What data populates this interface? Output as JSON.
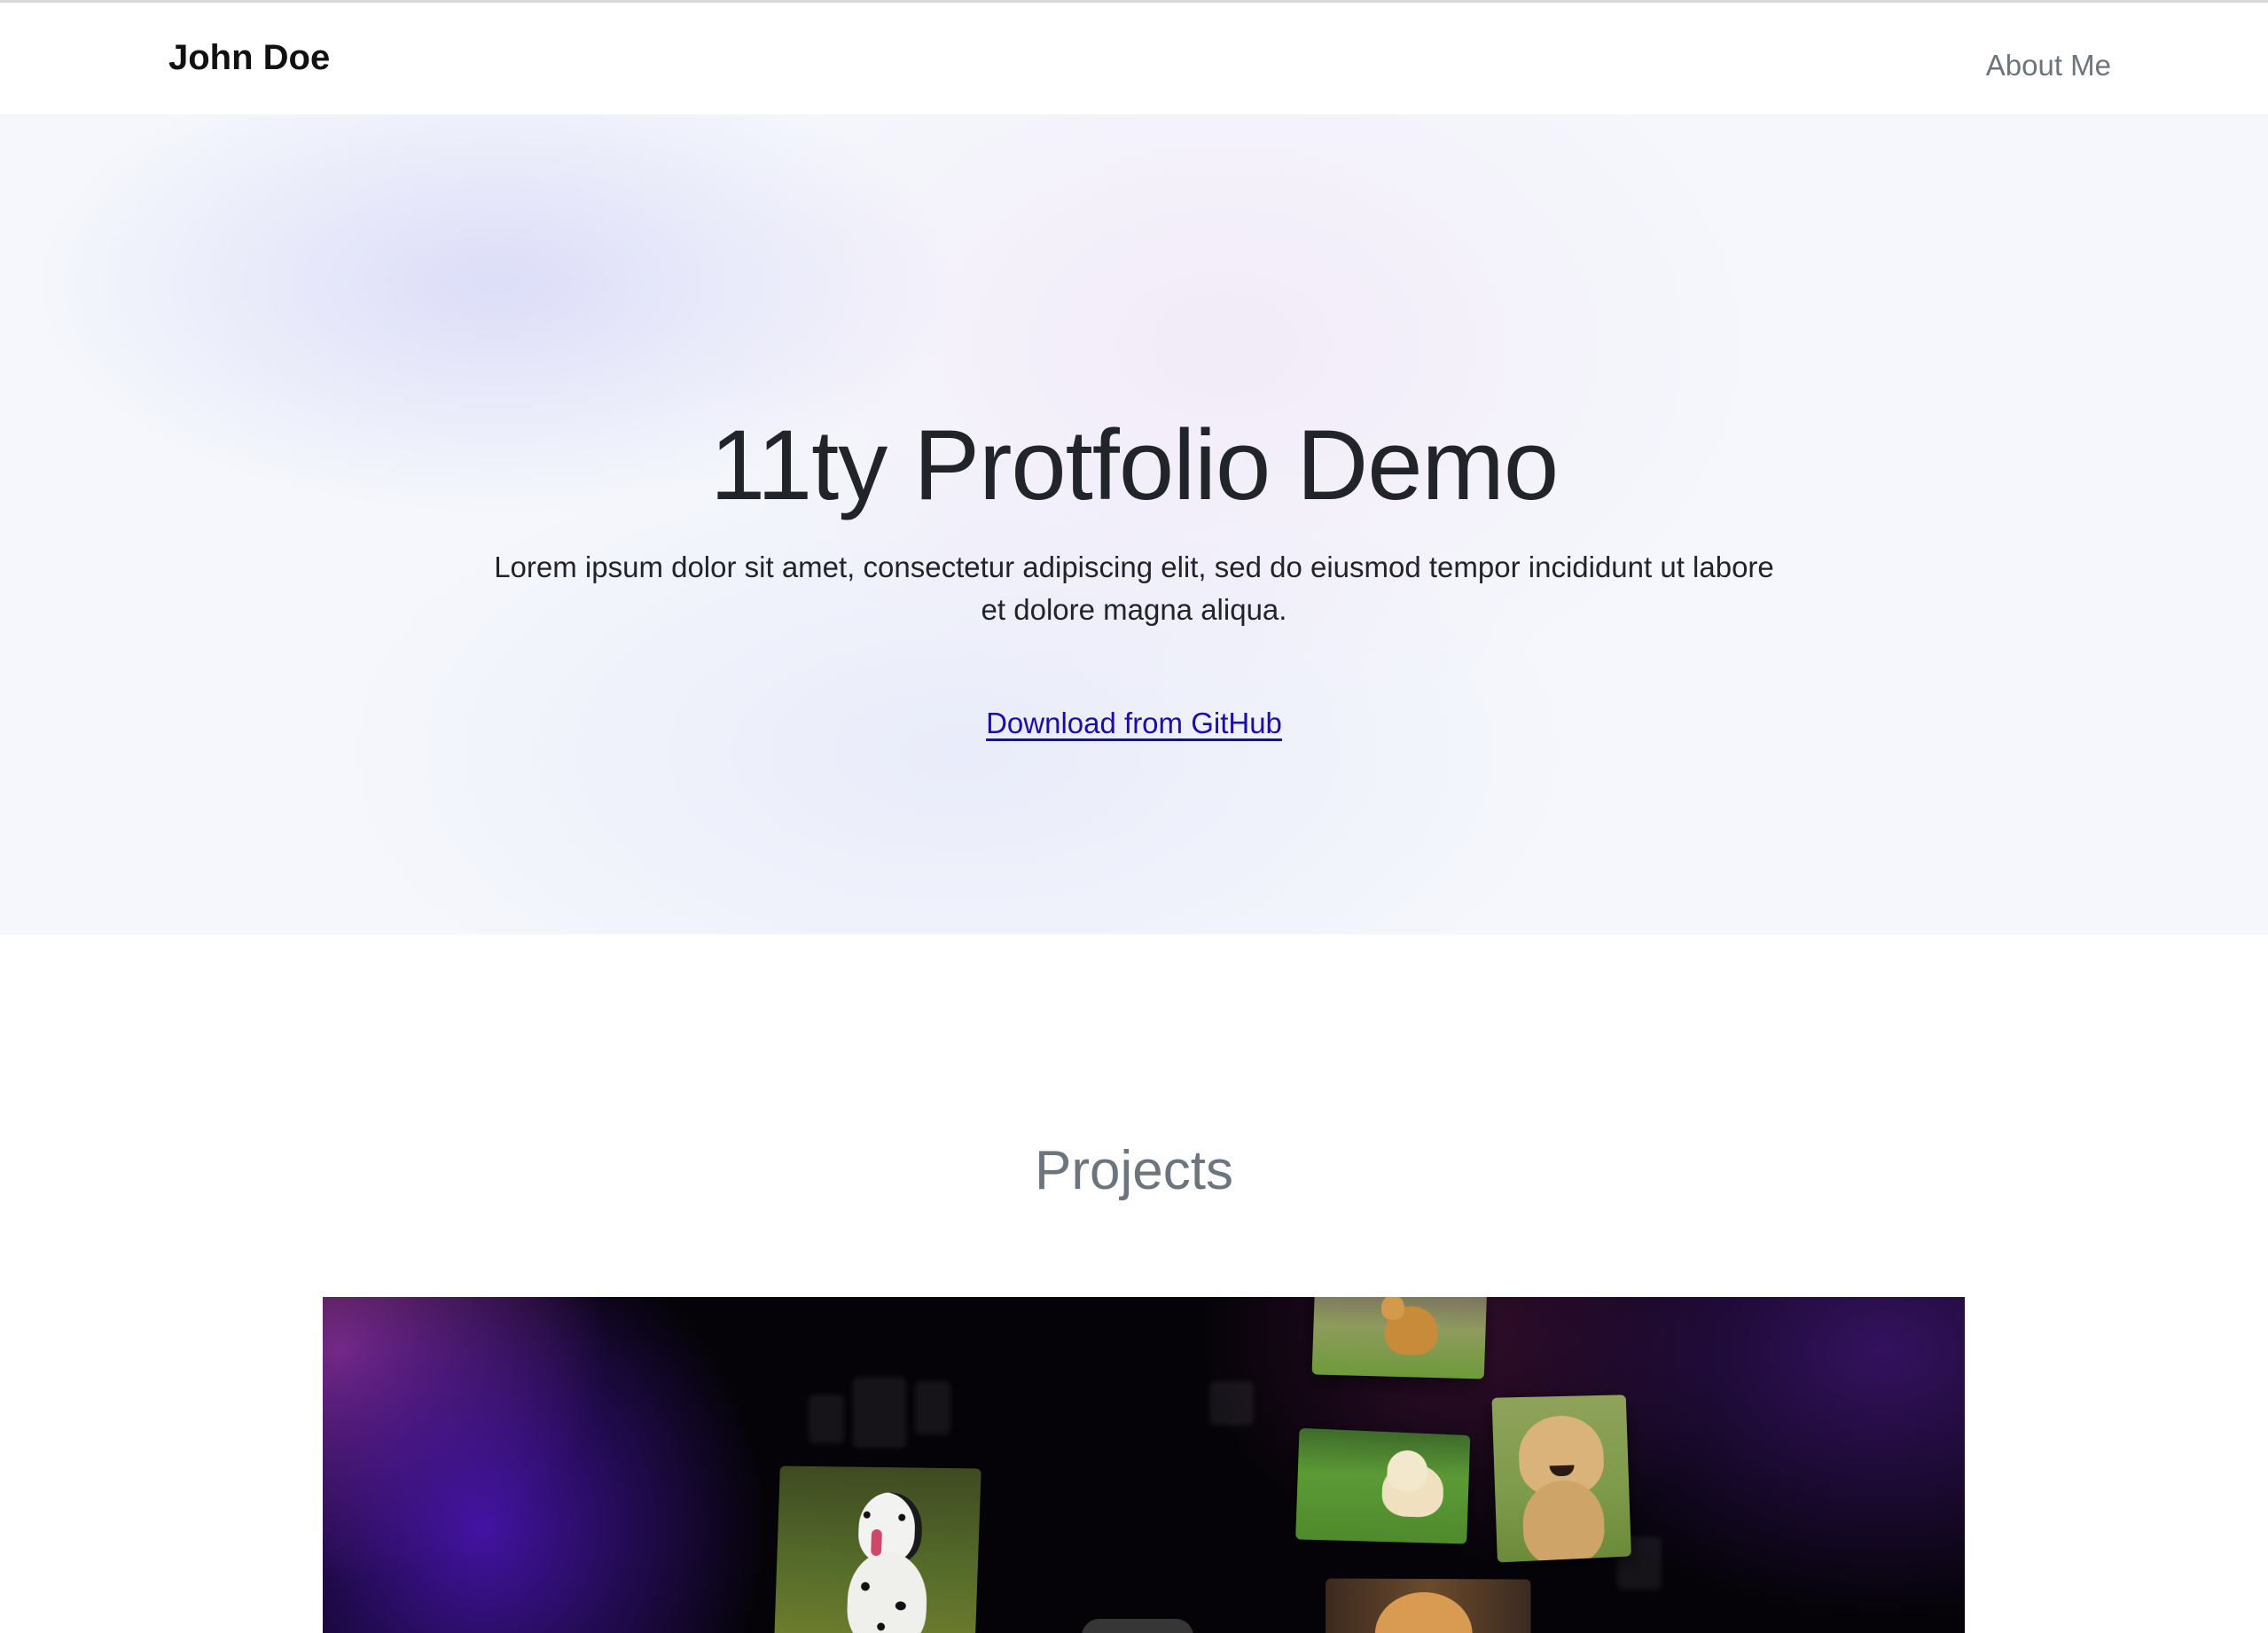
{
  "navbar": {
    "brand": "John Doe",
    "links": [
      {
        "label": "About Me"
      }
    ]
  },
  "hero": {
    "title": "11ty Protfolio Demo",
    "lead": "Lorem ipsum dolor sit amet, consectetur adipiscing elit, sed do eiusmod tempor incididunt ut labore et dolore magna aliqua.",
    "cta_label": "Download from GitHub"
  },
  "projects": {
    "heading": "Projects",
    "items": [
      {
        "image_description": "dog photo gallery preview"
      }
    ]
  },
  "colors": {
    "link": "#1a0dab",
    "muted": "#6c757d",
    "text": "#212529"
  }
}
